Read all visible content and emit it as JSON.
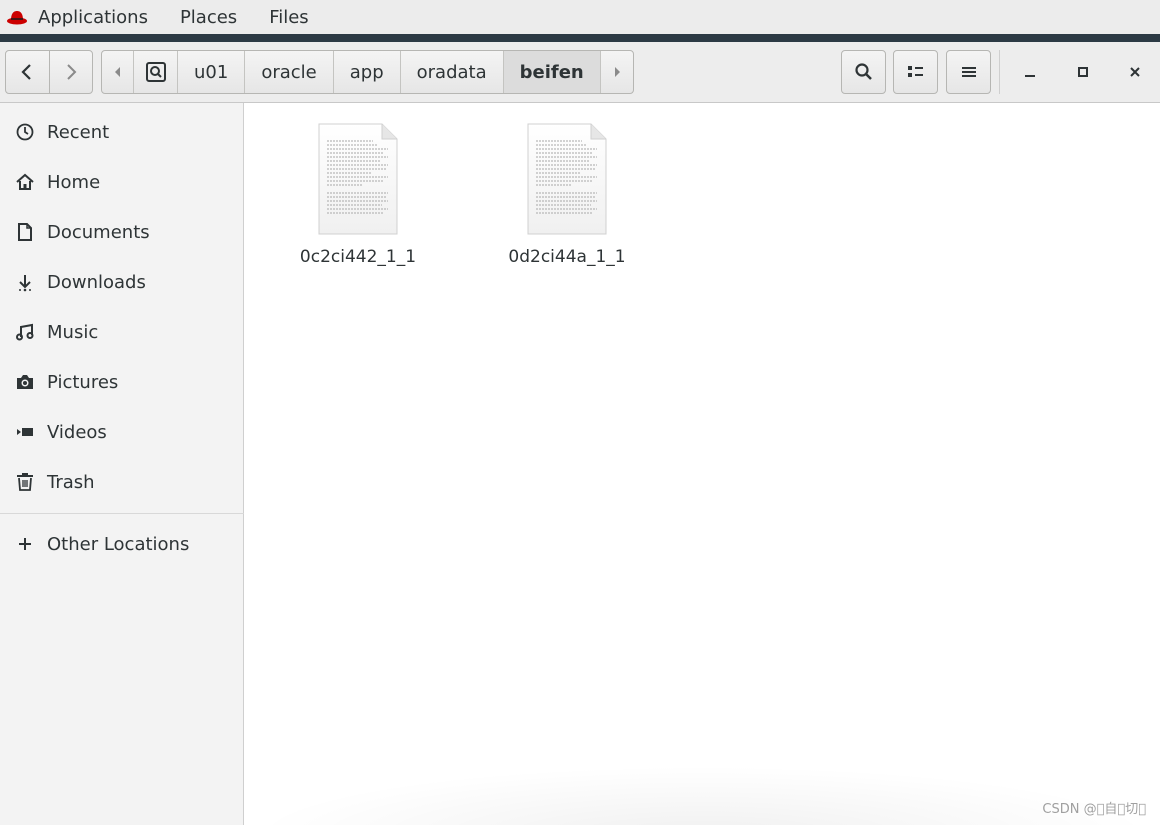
{
  "topbar": {
    "menus": [
      "Applications",
      "Places",
      "Files"
    ],
    "logo_icon": "redhat-logo-icon",
    "accent_color": "#2c3a44",
    "logo_color": "#cc0000"
  },
  "headerbar": {
    "path": [
      "u01",
      "oracle",
      "app",
      "oradata",
      "beifen"
    ],
    "active_segment": "beifen"
  },
  "sidebar": {
    "items": [
      {
        "label": "Recent",
        "icon": "clock-icon"
      },
      {
        "label": "Home",
        "icon": "home-icon"
      },
      {
        "label": "Documents",
        "icon": "document-icon"
      },
      {
        "label": "Downloads",
        "icon": "download-icon"
      },
      {
        "label": "Music",
        "icon": "music-icon"
      },
      {
        "label": "Pictures",
        "icon": "camera-icon"
      },
      {
        "label": "Videos",
        "icon": "video-icon"
      },
      {
        "label": "Trash",
        "icon": "trash-icon"
      }
    ],
    "other": {
      "label": "Other Locations",
      "icon": "plus-icon"
    }
  },
  "files": [
    {
      "name": "0c2ci442_1_1",
      "icon": "text-file-icon"
    },
    {
      "name": "0d2ci44a_1_1",
      "icon": "text-file-icon"
    }
  ],
  "watermark": "CSDN @\u0000自\u0000切\u0000"
}
